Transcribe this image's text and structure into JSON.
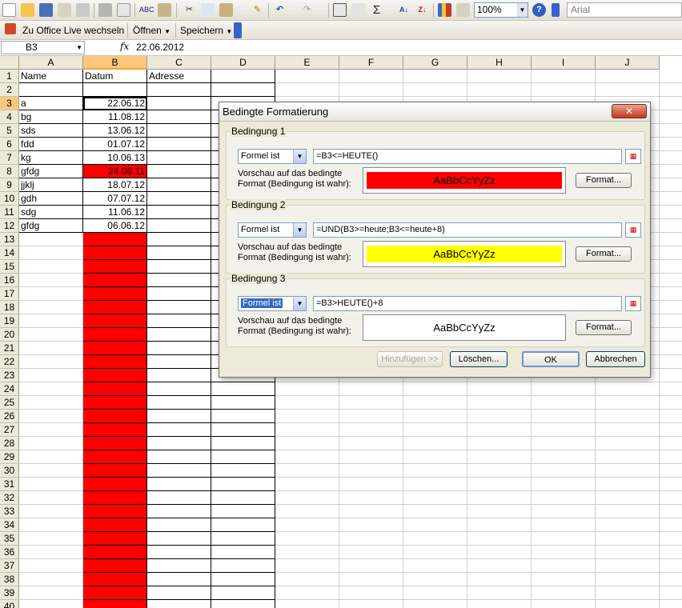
{
  "toolbar": {
    "zoom": "100%",
    "font": "Arial"
  },
  "toolbar2": {
    "office_live": "Zu Office Live wechseln",
    "open": "Öffnen",
    "save": "Speichern"
  },
  "formula_bar": {
    "name_box": "B3",
    "fx": "fx",
    "formula": "22.06.2012"
  },
  "sheet": {
    "columns": [
      "A",
      "B",
      "C",
      "D",
      "E",
      "F",
      "G",
      "H",
      "I",
      "J"
    ],
    "selected_column": "B",
    "selected_row": 3,
    "row_count": 40,
    "headers": [
      "Name",
      "Datum",
      "Adresse"
    ],
    "rows": [
      {
        "name": "a",
        "date": "22.06.12",
        "red": false
      },
      {
        "name": "bg",
        "date": "11.08.12",
        "red": false
      },
      {
        "name": "sds",
        "date": "13.06.12",
        "red": false
      },
      {
        "name": "fdd",
        "date": "01.07.12",
        "red": false
      },
      {
        "name": "kg",
        "date": "10.06.13",
        "red": false
      },
      {
        "name": "gfdg",
        "date": "24.06.11",
        "red": true
      },
      {
        "name": "jjklj",
        "date": "18.07.12",
        "red": false
      },
      {
        "name": "gdh",
        "date": "07.07.12",
        "red": false
      },
      {
        "name": "sdg",
        "date": "11.06.12",
        "red": false
      },
      {
        "name": "gfdg",
        "date": "06.06.12",
        "red": false
      }
    ],
    "red_fill_color": "#ff0000"
  },
  "dialog": {
    "title": "Bedingte Formatierung",
    "close": "✕",
    "preview_label_1": "Vorschau auf das bedingte",
    "preview_label_2": "Format (Bedingung ist wahr):",
    "conditions": [
      {
        "label": "Bedingung 1",
        "type": "Formel ist",
        "formula": "=B3<=HEUTE()",
        "preview": "AaBbCcYyZz",
        "fill": "#ff0000",
        "format_btn": "Format..."
      },
      {
        "label": "Bedingung 2",
        "type": "Formel ist",
        "formula": "=UND(B3>=heute;B3<=heute+8)",
        "preview": "AaBbCcYyZz",
        "fill": "#ffff00",
        "format_btn": "Format..."
      },
      {
        "label": "Bedingung 3",
        "type": "Formel ist",
        "formula": "=B3>HEUTE()+8",
        "preview": "AaBbCcYyZz",
        "fill": "#ffffff",
        "format_btn": "Format..."
      }
    ],
    "buttons": {
      "add": "Hinzufügen >>",
      "delete": "Löschen...",
      "ok": "OK",
      "cancel": "Abbrechen"
    }
  }
}
